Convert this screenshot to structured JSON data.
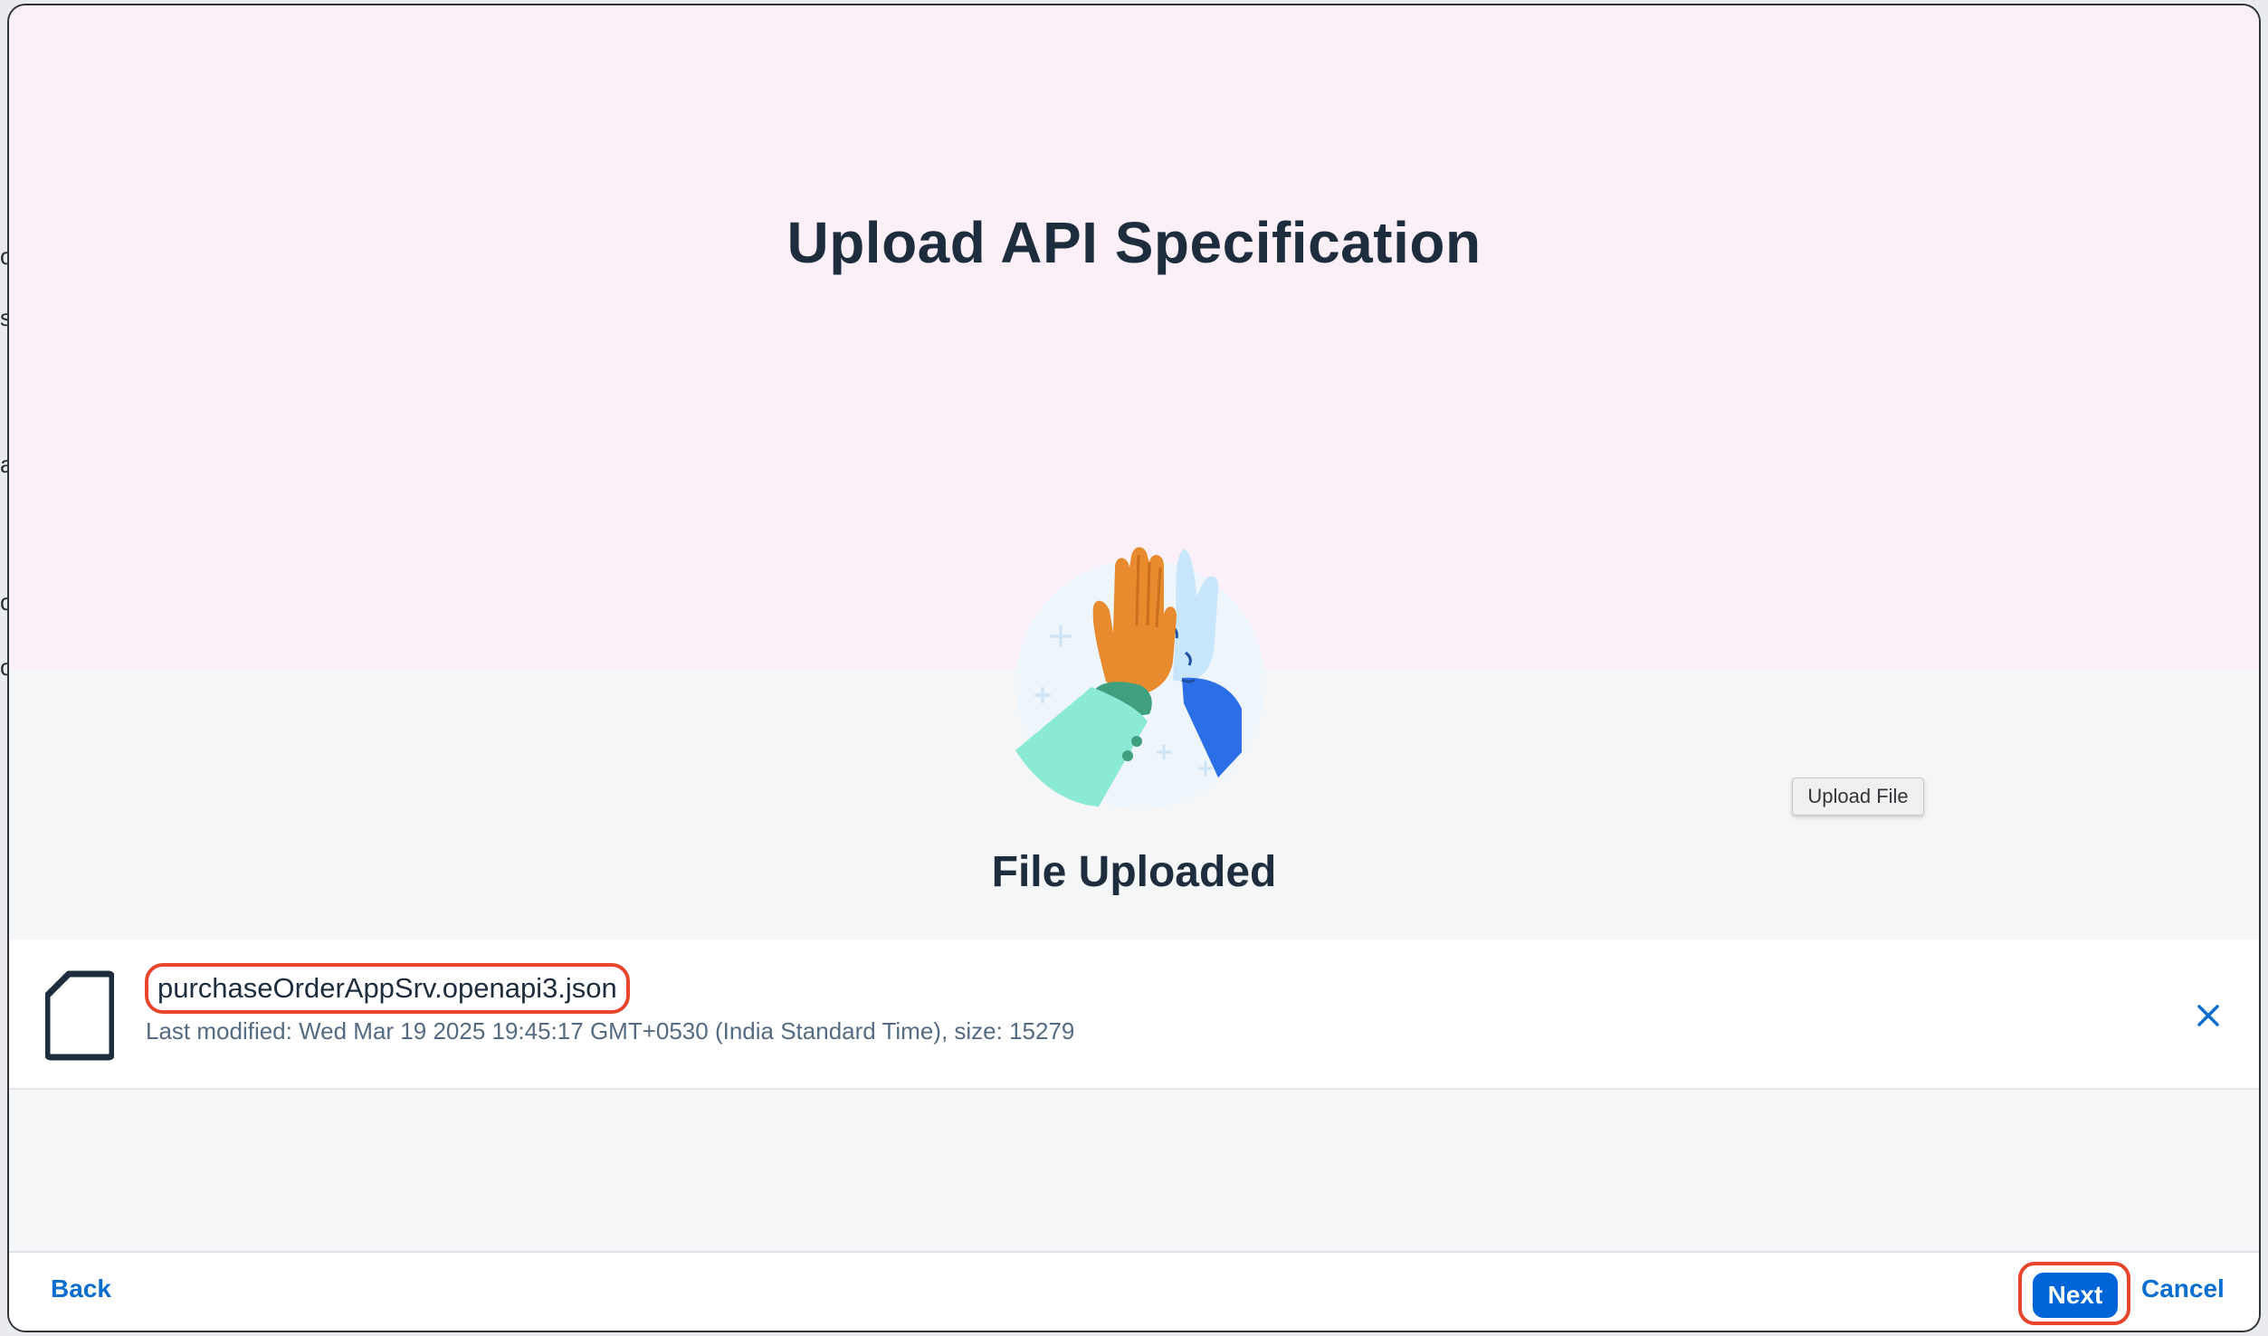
{
  "dialog": {
    "title": "Upload API Specification",
    "status_title": "File Uploaded",
    "tooltip": "Upload File",
    "illustration": "high-five-illustration"
  },
  "file": {
    "name": "purchaseOrderAppSrv.openapi3.json",
    "meta": "Last modified: Wed Mar 19 2025 19:45:17 GMT+0530 (India Standard Time), size: 15279",
    "icon": "document-icon",
    "remove_icon": "close-icon"
  },
  "footer": {
    "back_label": "Back",
    "next_label": "Next",
    "cancel_label": "Cancel"
  },
  "colors": {
    "header_band": "#fbeff8",
    "primary": "#0064d9",
    "link": "#0a6ed1",
    "highlight": "#e8452c",
    "title_text": "#1d2d3e"
  }
}
